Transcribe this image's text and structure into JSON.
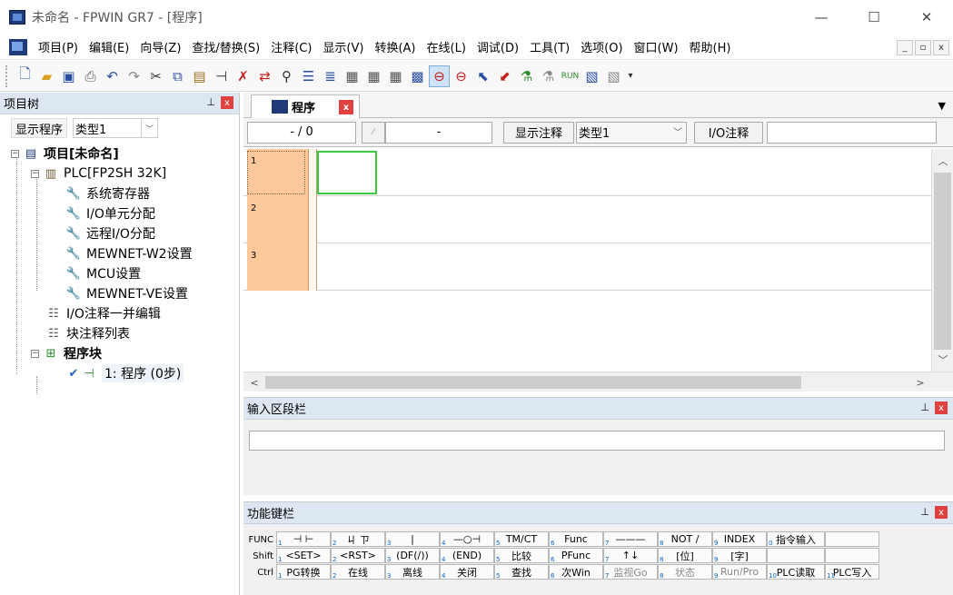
{
  "window": {
    "title": "未命名 - FPWIN GR7 - [程序]",
    "minimize": "—",
    "maximize": "☐",
    "close": "✕"
  },
  "menu": {
    "items": [
      "项目(P)",
      "编辑(E)",
      "向导(Z)",
      "查找/替换(S)",
      "注释(C)",
      "显示(V)",
      "转换(A)",
      "在线(L)",
      "调试(D)",
      "工具(T)",
      "选项(O)",
      "窗口(W)",
      "帮助(H)"
    ],
    "mdi_min": "_",
    "mdi_restore": "▫",
    "mdi_close": "x"
  },
  "toolbar": {
    "icons": [
      "new-file-icon",
      "open-folder-icon",
      "save-icon",
      "print-icon",
      "undo-icon",
      "redo-icon",
      "cut-icon",
      "copy-icon",
      "paste-icon",
      "insert-icon",
      "delete-icon",
      "replace-icon",
      "find-icon",
      "comment-icon",
      "list-icon",
      "monitor-icon",
      "monitor2-icon",
      "monitor3-icon",
      "plc-active-icon",
      "plc-icon",
      "upload-icon",
      "download-icon",
      "tool-icon",
      "tool2-icon",
      "run-icon",
      "table-icon",
      "table2-icon"
    ]
  },
  "project_tree": {
    "header": "项目树",
    "pin": "⊥",
    "close": "x",
    "show_program_btn": "显示程序",
    "type_select": "类型1",
    "nodes": {
      "project": "项目[未命名]",
      "plc": "PLC[FP2SH 32K]",
      "system_registers": "系统寄存器",
      "io_unit": "I/O单元分配",
      "remote_io": "远程I/O分配",
      "mewnet_w2": "MEWNET-W2设置",
      "mcu": "MCU设置",
      "mewnet_ve": "MEWNET-VE设置",
      "io_comment": "I/O注释一并编辑",
      "block_comment": "块注释列表",
      "program_block": "程序块",
      "program1": "1: 程序 (0步)"
    }
  },
  "editor": {
    "tab_label": "程序",
    "tab_close": "x",
    "step_display": "- /     0",
    "middle_field": "-",
    "show_comment_btn": "显示注释",
    "type_select": "类型1",
    "io_comment_btn": "I/O注释",
    "rungs": [
      "1",
      "2",
      "3"
    ]
  },
  "input_section": {
    "header": "输入区段栏",
    "value": ""
  },
  "function_keys": {
    "header": "功能键栏",
    "rows": [
      {
        "label": "FUNC",
        "keys": [
          {
            "n": "1",
            "t": "⊣ ⊢"
          },
          {
            "n": "2",
            "t": "ㄐ ㄗ"
          },
          {
            "n": "3",
            "t": "|"
          },
          {
            "n": "4",
            "t": "—○⊣"
          },
          {
            "n": "5",
            "t": "TM/CT"
          },
          {
            "n": "6",
            "t": "Func"
          },
          {
            "n": "7",
            "t": "———"
          },
          {
            "n": "8",
            "t": "NOT /"
          },
          {
            "n": "9",
            "t": "INDEX"
          },
          {
            "n": "0",
            "t": "指令输入"
          },
          {
            "n": "",
            "t": ""
          }
        ]
      },
      {
        "label": "Shift",
        "keys": [
          {
            "n": "1",
            "t": "<SET>"
          },
          {
            "n": "2",
            "t": "<RST>"
          },
          {
            "n": "3",
            "t": "(DF(/))"
          },
          {
            "n": "4",
            "t": "(END)"
          },
          {
            "n": "5",
            "t": "比较"
          },
          {
            "n": "6",
            "t": "PFunc"
          },
          {
            "n": "7",
            "t": "↑↓"
          },
          {
            "n": "8",
            "t": "[位]"
          },
          {
            "n": "9",
            "t": "[字]"
          },
          {
            "n": "",
            "t": ""
          },
          {
            "n": "",
            "t": ""
          }
        ]
      },
      {
        "label": "Ctrl",
        "keys": [
          {
            "n": "1",
            "t": "PG转换"
          },
          {
            "n": "2",
            "t": "在线"
          },
          {
            "n": "3",
            "t": "离线"
          },
          {
            "n": "4",
            "t": "关闭"
          },
          {
            "n": "5",
            "t": "查找"
          },
          {
            "n": "6",
            "t": "次Win"
          },
          {
            "n": "7",
            "t": "监视Go"
          },
          {
            "n": "8",
            "t": "状态"
          },
          {
            "n": "9",
            "t": "Run/Pro"
          },
          {
            "n": "10",
            "t": "PLC读取"
          },
          {
            "n": "11",
            "t": "PLC写入"
          }
        ]
      }
    ]
  }
}
